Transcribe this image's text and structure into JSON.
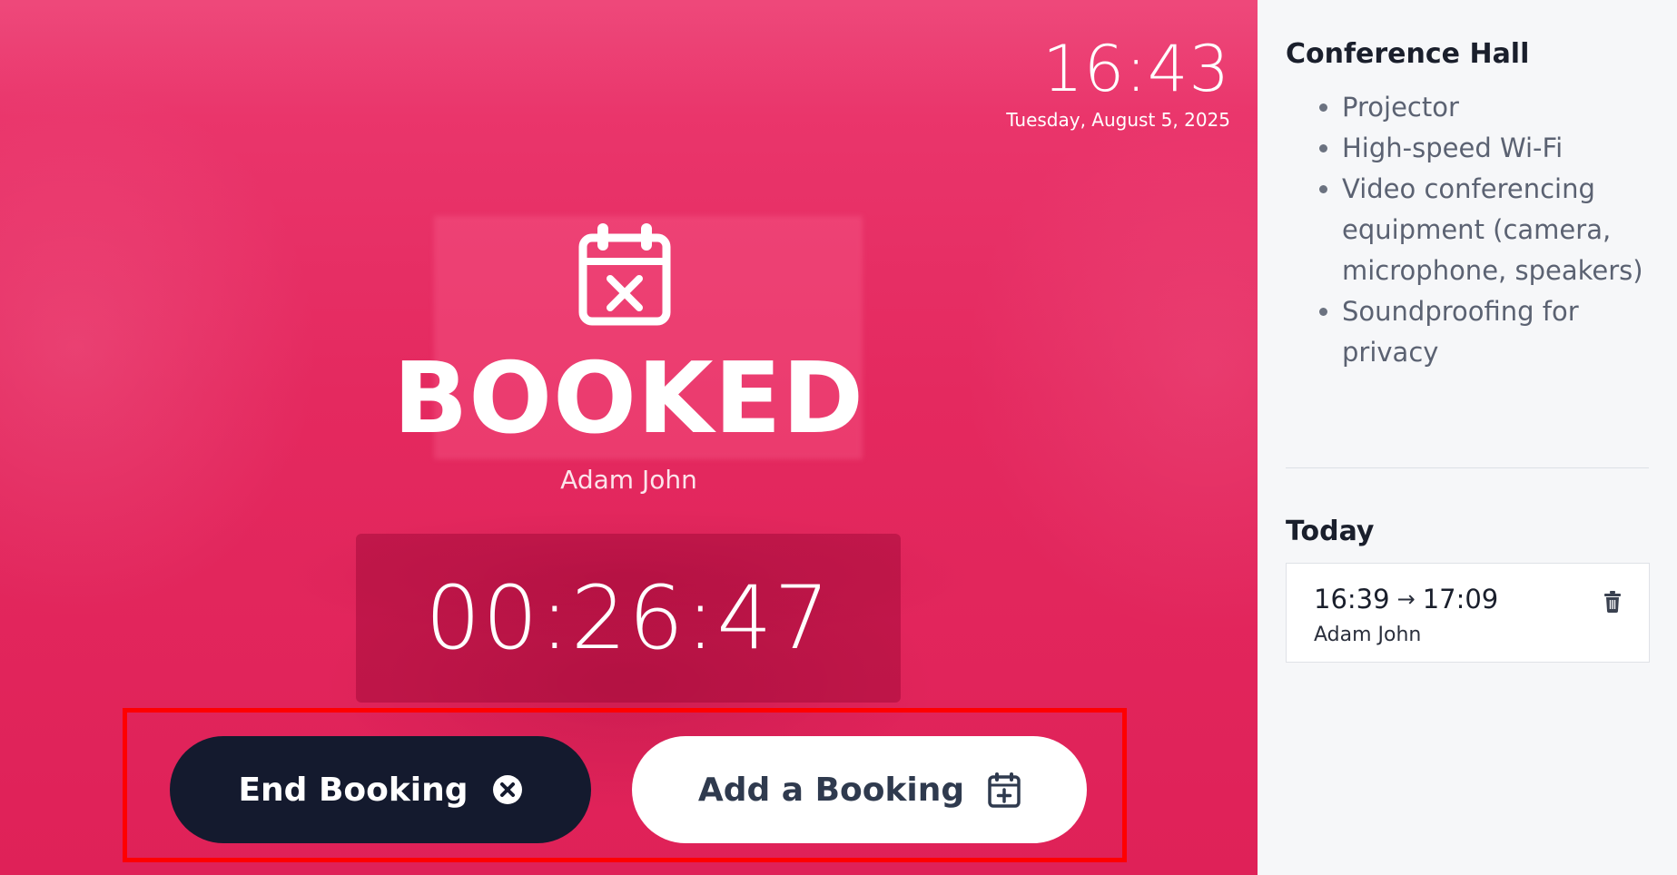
{
  "clock": {
    "time": "16:43",
    "date": "Tuesday, August 5, 2025"
  },
  "status": {
    "icon": "calendar-x-icon",
    "title": "BOOKED",
    "owner": "Adam John",
    "countdown": "00:26:47",
    "color": "#e4295f"
  },
  "actions": {
    "end_booking_label": "End Booking",
    "end_booking_icon": "close-circle-icon",
    "add_booking_label": "Add a Booking",
    "add_booking_icon": "calendar-plus-icon"
  },
  "sidebar": {
    "room_name": "Conference Hall",
    "amenities": [
      "Projector",
      "High-speed Wi-Fi",
      "Video conferencing equipment (camera, microphone, speakers)",
      "Soundproofing for privacy"
    ],
    "today_title": "Today",
    "bookings": [
      {
        "start": "16:39",
        "end": "17:09",
        "arrow": "→",
        "person": "Adam John",
        "delete_icon": "trash-icon"
      }
    ]
  }
}
